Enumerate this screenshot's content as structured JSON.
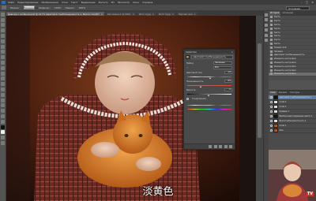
{
  "menubar": {
    "items": [
      "Файл",
      "Редактирование",
      "Изображение",
      "Слои",
      "Текст",
      "Выделение",
      "Фильтр",
      "3D",
      "Просмотр",
      "Окно",
      "Справка"
    ],
    "controls": [
      "–",
      "□",
      "×"
    ]
  },
  "options_bar": {
    "items": [
      "Режим:",
      "Нормальный",
      "Непрозр.:",
      "100%",
      "Нажим:",
      "100%"
    ],
    "workspace": "Основная рабочая"
  },
  "tabs": [
    {
      "label": "Девочка с котёнком.psd @ 16,7% (Цветовой тон/Насыщенность 1, Маска слоя/8)*",
      "close": "×",
      "active": true
    },
    {
      "label": "Без имени-1 @ 100%",
      "close": "×",
      "active": false
    },
    {
      "label": "Фото 2.jpg",
      "close": "×",
      "active": false
    },
    {
      "label": "Фото 3.jpg",
      "close": "×",
      "active": false
    },
    {
      "label": "Портрет.psd",
      "close": "×",
      "active": false
    }
  ],
  "dialog": {
    "title": "Свойства",
    "close": "×",
    "preset": "Цветовой тон/Насыщенность",
    "channel_label": "Набор:",
    "channel_value": "Заказная",
    "range_label": "Все",
    "rows": [
      {
        "label": "Цветовой тон:",
        "value": "+6",
        "slider": 0.53
      },
      {
        "label": "Насыщенность:",
        "value": "-35",
        "slider": 0.32
      },
      {
        "label": "Яркость:",
        "value": "0",
        "slider": 0.5
      }
    ],
    "options": [
      "Тонирование"
    ]
  },
  "subtitle": "淡黄色",
  "panels": {
    "tabs": [
      "История",
      "Операции"
    ],
    "history": [
      "Кисть",
      "Кисть",
      "Кисть",
      "Кисть",
      "Кисть",
      "Кисть",
      "Кисть",
      "Кисть",
      "Новый слой",
      "Заливка",
      "Цветовой тон/Насыщенность",
      "Изменить настройки",
      "Изменить настройки",
      "Изменить настройки",
      "Изменить настройки",
      "Изменить настройки"
    ],
    "history_selected": 15,
    "layers_tabs": [
      "Слои",
      "Каналы",
      "Контуры"
    ],
    "layers": [
      {
        "name": "Цветовой тон/Насыщенность 1",
        "thumb": "mask",
        "selected": true
      },
      {
        "name": "Слой 3",
        "thumb": "white",
        "selected": false
      },
      {
        "name": "Слой 2",
        "thumb": "white",
        "selected": false
      },
      {
        "name": "Кривые 1",
        "thumb": "white",
        "selected": false
      },
      {
        "name": "Выборочная коррекция цвета 1",
        "thumb": "mask",
        "selected": false
      },
      {
        "name": "Яркость/Контрастность 1",
        "thumb": "white",
        "selected": false
      },
      {
        "name": "Слой 1",
        "thumb": "img",
        "selected": false
      },
      {
        "name": "Фон",
        "thumb": "img",
        "selected": false
      }
    ]
  },
  "webcam": {
    "badge": "TV"
  },
  "colors": {
    "ui_bg": "#535353",
    "panel_bg": "#4b4b4b",
    "selection": "#5e7ea6",
    "subtitle": "#ffffff"
  }
}
